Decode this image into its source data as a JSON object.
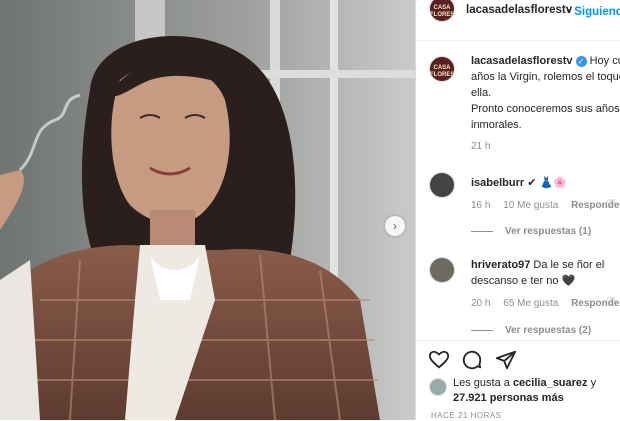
{
  "post": {
    "author": "lacasadelasflorestv",
    "follow_label": "Siguiendo",
    "follow_prefix": "•",
    "avatar_text": "CASA FLORES",
    "caption_lines": [
      "Hoy cumple",
      "años la Virgin, rolemos el toque a",
      "ella.",
      "Pronto conoceremos sus años",
      "inmorales."
    ],
    "caption_time": "21 h"
  },
  "comments": [
    {
      "user": "isabelburr",
      "text": "✔ 👗🌸",
      "time": "16 h",
      "likes": "10 Me gusta",
      "reply_label": "Responder",
      "view_replies": "Ver respuestas (1)"
    },
    {
      "user": "hriverato97",
      "text": "Da le se ñor el descanso e ter no 🖤",
      "time": "20 h",
      "likes": "65 Me gusta",
      "reply_label": "Responder",
      "view_replies": "Ver respuestas (2)"
    }
  ],
  "footer": {
    "likes_prefix": "Les gusta a ",
    "likes_user": "cecilia_suarez",
    "likes_mid": " y",
    "likes_count": "27.921 personas más",
    "time_ago": "HACE 21 HORAS"
  },
  "colors": {
    "link": "#0095f6",
    "verified": "#3897f0",
    "muted": "#8e8e8e"
  },
  "icons": [
    "like-icon",
    "comment-icon",
    "share-icon",
    "next-arrow-icon",
    "verified-icon"
  ]
}
